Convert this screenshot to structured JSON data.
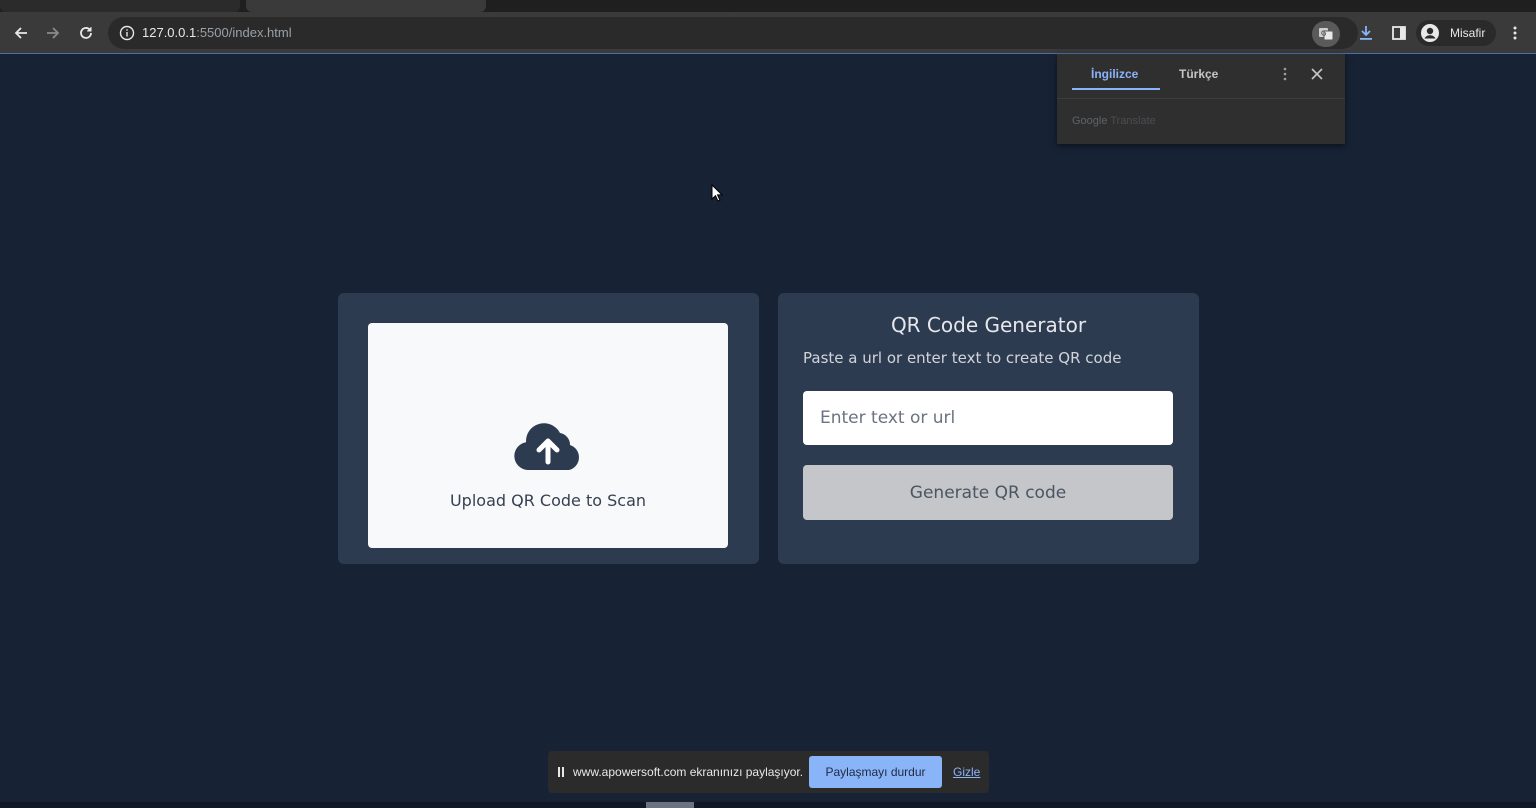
{
  "browser": {
    "url_host": "127.0.0.1",
    "url_rest": ":5500/index.html",
    "profile_name": "Misafir"
  },
  "translate_popup": {
    "tab_source": "İngilizce",
    "tab_target": "Türkçe",
    "footer_google": "Google",
    "footer_translate": " Translate"
  },
  "page": {
    "upload_label": "Upload QR Code to Scan",
    "title": "QR Code Generator",
    "subtitle": "Paste a url or enter text to create QR code",
    "input_placeholder": "Enter text or url",
    "input_value": "",
    "button_label": "Generate QR code"
  },
  "share_bar": {
    "message": "www.apowersoft.com ekranınızı paylaşıyor.",
    "stop_label": "Paylaşmayı durdur",
    "hide_label": "Gizle"
  },
  "colors": {
    "page_bg": "#172235",
    "card_bg": "#2d3b50",
    "accent": "#8ab4f8"
  }
}
